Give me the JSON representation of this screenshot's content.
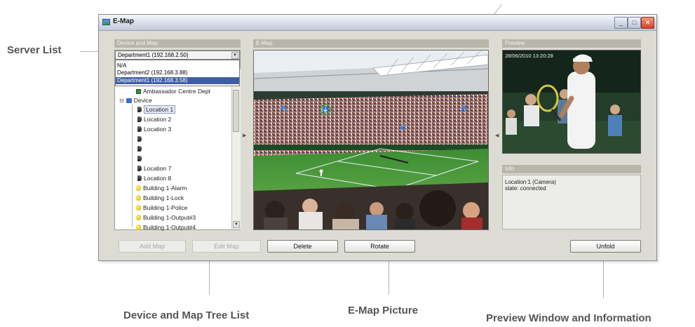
{
  "callouts": {
    "server_list": "Server List",
    "tree_list": "Device and Map Tree List",
    "emap_picture": "E-Map Picture",
    "preview": "Preview Window and Information"
  },
  "window": {
    "title": "E-Map",
    "buttons": {
      "minimize": "_",
      "maximize": "□",
      "close": "✕"
    }
  },
  "left_panel": {
    "header": "Device and Map",
    "server_select": "Department1 (192.168.2.50)",
    "dropdown_options": [
      "N/A",
      "Department2 (192.168.3.88)",
      "Department1 (192.168.3.58)"
    ],
    "tree": {
      "partial_item": "Ambassador Centre Dept",
      "device_root": "Device",
      "items": [
        {
          "label": "Location 1",
          "icon": "camera-icon",
          "selected": true
        },
        {
          "label": "Location 2",
          "icon": "camera-icon"
        },
        {
          "label": "Location 3",
          "icon": "camera-icon"
        },
        {
          "label": "",
          "icon": "camera-icon"
        },
        {
          "label": "",
          "icon": "camera-icon"
        },
        {
          "label": "",
          "icon": "camera-icon"
        },
        {
          "label": "Location 7",
          "icon": "camera-icon"
        },
        {
          "label": "Location 8",
          "icon": "camera-icon"
        },
        {
          "label": "Building 1-Alarm",
          "icon": "bulb-icon"
        },
        {
          "label": "Building 1-Lock",
          "icon": "bulb-icon"
        },
        {
          "label": "Building 1-Police",
          "icon": "bulb-icon"
        },
        {
          "label": "Building 1-Output#3",
          "icon": "bulb-icon"
        },
        {
          "label": "Building 1-Output#4",
          "icon": "bulb-icon"
        }
      ]
    }
  },
  "center_panel": {
    "header": "E-Map"
  },
  "right_panel": {
    "preview_header": "Preview",
    "timestamp": "28/06/2010  13:20:28",
    "info_header": "Info",
    "info_lines": [
      "Location 1 (Camera)",
      "state: connected"
    ]
  },
  "buttons": {
    "add_map": "Add Map",
    "edit_map": "Edit Map",
    "delete": "Delete",
    "rotate": "Rotate",
    "unfold": "Unfold"
  },
  "colors": {
    "window_bg": "#dcdcd4",
    "panel_header": "#b7b6ab",
    "selection": "#3d5fa8",
    "close_button": "#d1442a"
  }
}
